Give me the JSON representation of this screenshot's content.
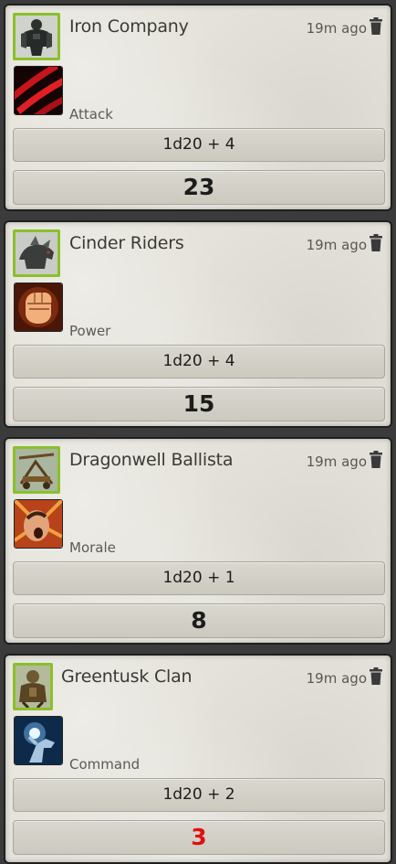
{
  "chat_log": {
    "cards": [
      {
        "speaker": "Iron Company",
        "timestamp": "19m ago",
        "flavor": "Attack",
        "formula": "1d20 + 4",
        "total": "23",
        "total_color": "#1c1c1c",
        "portrait_icon": "armored-golem-icon",
        "ability_icon": "red-claw-slash-icon"
      },
      {
        "speaker": "Cinder Riders",
        "timestamp": "19m ago",
        "flavor": "Power",
        "formula": "1d20 + 4",
        "total": "15",
        "total_color": "#1c1c1c",
        "portrait_icon": "beast-mount-icon",
        "ability_icon": "clenched-fist-icon"
      },
      {
        "speaker": "Dragonwell Ballista",
        "timestamp": "19m ago",
        "flavor": "Morale",
        "formula": "1d20 + 1",
        "total": "8",
        "total_color": "#1c1c1c",
        "portrait_icon": "siege-ballista-icon",
        "ability_icon": "battle-cry-face-icon"
      },
      {
        "speaker": "Greentusk Clan",
        "timestamp": "19m ago",
        "flavor": "Command",
        "formula": "1d20 + 2",
        "total": "3",
        "total_color": "#e01010",
        "portrait_icon": "orc-warrior-icon",
        "ability_icon": "pointing-hand-light-icon"
      }
    ]
  }
}
